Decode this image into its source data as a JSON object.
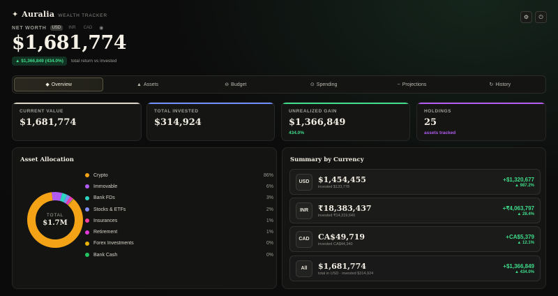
{
  "brand": {
    "name": "Auralia",
    "subtitle": "WEALTH TRACKER"
  },
  "header": {
    "net_worth_label": "NET WORTH",
    "currencies": [
      "USD",
      "INR",
      "CAD"
    ],
    "selected_currency": "USD",
    "net_worth_value": "$1,681,774",
    "gain_badge": "▲ $1,366,849 (434.0%)",
    "gain_note": "total return vs invested"
  },
  "icons": {
    "settings": "gear-icon",
    "power": "power-icon",
    "visibility": "eye-icon"
  },
  "tabs": [
    {
      "label": "Overview",
      "icon": "◆"
    },
    {
      "label": "Assets",
      "icon": "▲"
    },
    {
      "label": "Budget",
      "icon": "⊖"
    },
    {
      "label": "Spending",
      "icon": "⊙"
    },
    {
      "label": "Projections",
      "icon": "~"
    },
    {
      "label": "History",
      "icon": "↻"
    }
  ],
  "active_tab": "Overview",
  "stats": {
    "current_value": {
      "label": "CURRENT VALUE",
      "value": "$1,681,774",
      "color": "#d9d4c7"
    },
    "total_invested": {
      "label": "TOTAL INVESTED",
      "value": "$314,924",
      "color": "#6c8cff"
    },
    "unrealized_gain": {
      "label": "UNREALIZED GAIN",
      "value": "$1,366,849",
      "sub": "434.0%",
      "color": "#3fdc8a"
    },
    "holdings": {
      "label": "HOLDINGS",
      "value": "25",
      "sub": "assets tracked",
      "color": "#b05cf0"
    }
  },
  "allocation": {
    "title": "Asset Allocation",
    "total_label": "TOTAL",
    "total_value": "$1.7M",
    "items": [
      {
        "name": "Crypto",
        "pct": "86%",
        "value": 86,
        "color": "#f5a316"
      },
      {
        "name": "Immovable",
        "pct": "6%",
        "value": 6,
        "color": "#b05cf0"
      },
      {
        "name": "Bank FDs",
        "pct": "3%",
        "value": 3,
        "color": "#2dd4bf"
      },
      {
        "name": "Stocks & ETFs",
        "pct": "2%",
        "value": 2,
        "color": "#818cf8"
      },
      {
        "name": "Insurances",
        "pct": "1%",
        "value": 1,
        "color": "#f43f9e"
      },
      {
        "name": "Retirement",
        "pct": "1%",
        "value": 1,
        "color": "#e23ad8"
      },
      {
        "name": "Forex Investments",
        "pct": "0%",
        "value": 0.4,
        "color": "#eab308"
      },
      {
        "name": "Bank Cash",
        "pct": "0%",
        "value": 0.3,
        "color": "#22c55e"
      }
    ]
  },
  "currency_summary": {
    "title": "Summary by Currency",
    "rows": [
      {
        "code": "USD",
        "amount": "$1,454,455",
        "invested": "invested $133,778",
        "gain": "+$1,320,677",
        "gain_pct": "▲ 987.2%"
      },
      {
        "code": "INR",
        "amount": "₹18,383,437",
        "invested": "invested ₹14,319,640",
        "gain": "+₹4,063,797",
        "gain_pct": "▲ 28.4%"
      },
      {
        "code": "CAD",
        "amount": "CA$49,719",
        "invested": "invested CA$44,340",
        "gain": "+CA$5,379",
        "gain_pct": "▲ 12.1%"
      },
      {
        "code": "All",
        "amount": "$1,681,774",
        "invested": "total in USD · invested $314,924",
        "gain": "+$1,366,849",
        "gain_pct": "▲ 434.0%"
      }
    ]
  }
}
